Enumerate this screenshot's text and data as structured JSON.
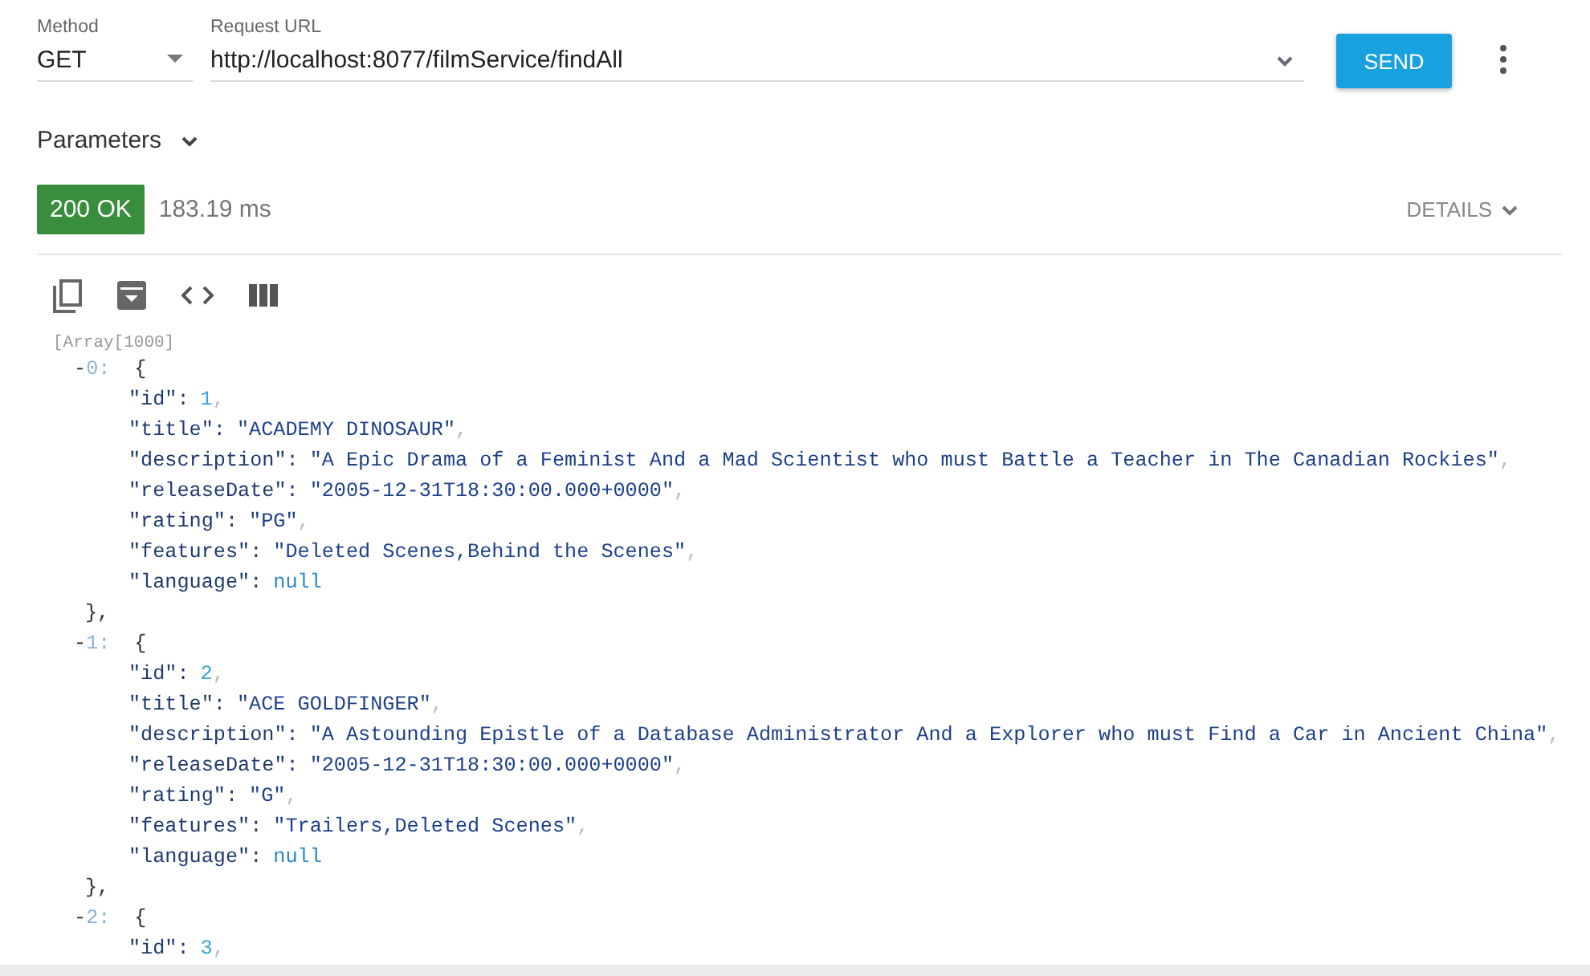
{
  "request": {
    "method_label": "Method",
    "method": "GET",
    "url_label": "Request URL",
    "url": "http://localhost:8077/filmService/findAll",
    "send": "SEND"
  },
  "parameters": {
    "label": "Parameters",
    "expanded": false
  },
  "response": {
    "status": "200 OK",
    "time": "183.19 ms",
    "details": "DETAILS"
  },
  "viewer": {
    "array_label": "[Array[1000]",
    "items": [
      {
        "toggle": "-",
        "index": "0:",
        "open": "{",
        "close": "},",
        "fields": [
          {
            "key": "\"id\":",
            "value": "1",
            "kind": "number",
            "comma": ","
          },
          {
            "key": "\"title\":",
            "value": "\"ACADEMY DINOSAUR\"",
            "kind": "string",
            "comma": ","
          },
          {
            "key": "\"description\":",
            "value": "\"A Epic Drama of a Feminist And a Mad Scientist who must Battle a Teacher in The Canadian Rockies\"",
            "kind": "string",
            "comma": ","
          },
          {
            "key": "\"releaseDate\":",
            "value": "\"2005-12-31T18:30:00.000+0000\"",
            "kind": "string",
            "comma": ","
          },
          {
            "key": "\"rating\":",
            "value": "\"PG\"",
            "kind": "string",
            "comma": ","
          },
          {
            "key": "\"features\":",
            "value": "\"Deleted Scenes,Behind the Scenes\"",
            "kind": "string",
            "comma": ","
          },
          {
            "key": "\"language\":",
            "value": "null",
            "kind": "null"
          }
        ]
      },
      {
        "toggle": "-",
        "index": "1:",
        "open": "{",
        "close": "},",
        "fields": [
          {
            "key": "\"id\":",
            "value": "2",
            "kind": "number",
            "comma": ","
          },
          {
            "key": "\"title\":",
            "value": "\"ACE GOLDFINGER\"",
            "kind": "string",
            "comma": ","
          },
          {
            "key": "\"description\":",
            "value": "\"A Astounding Epistle of a Database Administrator And a Explorer who must Find a Car in Ancient China\"",
            "kind": "string",
            "comma": ","
          },
          {
            "key": "\"releaseDate\":",
            "value": "\"2005-12-31T18:30:00.000+0000\"",
            "kind": "string",
            "comma": ","
          },
          {
            "key": "\"rating\":",
            "value": "\"G\"",
            "kind": "string",
            "comma": ","
          },
          {
            "key": "\"features\":",
            "value": "\"Trailers,Deleted Scenes\"",
            "kind": "string",
            "comma": ","
          },
          {
            "key": "\"language\":",
            "value": "null",
            "kind": "null"
          }
        ]
      },
      {
        "toggle": "-",
        "index": "2:",
        "open": "{",
        "fields": [
          {
            "key": "\"id\":",
            "value": "3",
            "kind": "number",
            "comma": ","
          }
        ]
      }
    ]
  }
}
